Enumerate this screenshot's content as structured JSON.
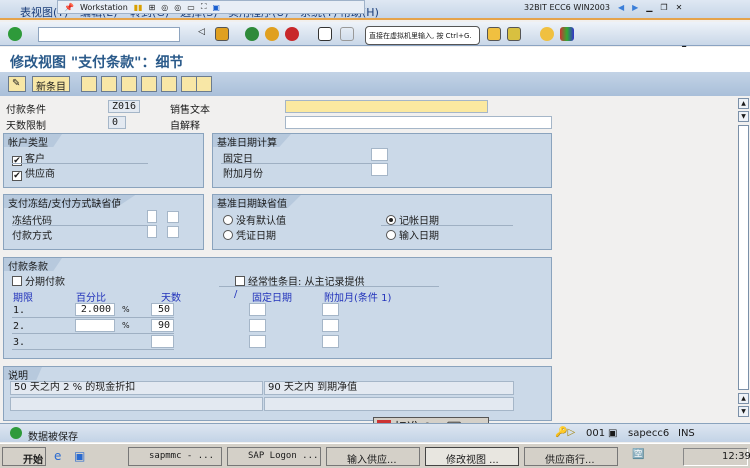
{
  "menu": {
    "items": [
      "表视图(T)",
      "编辑(E)",
      "转到(G)",
      "选择(S)",
      "实用程序(U)",
      "系统(Y)",
      "帮助(H)"
    ]
  },
  "vm": {
    "workstation": "Workstation",
    "vm_name": "32BIT ECC6 WIN2003"
  },
  "tooltip": "直接在虚拟机里输入, 按 Ctrl+G.",
  "command_field": {
    "value": ""
  },
  "page_title": "修改视图 \"支付条款\"：细节",
  "app_toolbar": {
    "new_entries": "新条目"
  },
  "header": {
    "payment_terms_label": "付款条件",
    "payment_terms_value": "Z016",
    "day_limit_label": "天数限制",
    "day_limit_value": "0",
    "sales_text_label": "销售文本",
    "sales_text_value": "",
    "own_explanation_label": "自解释",
    "own_explanation_value": ""
  },
  "account_type": {
    "title": "帐户类型",
    "customer": "客户",
    "customer_checked": true,
    "vendor": "供应商",
    "vendor_checked": true
  },
  "baseline_calc": {
    "title": "基准日期计算",
    "fixed_day": "固定日",
    "additional_months": "附加月份"
  },
  "payment_block": {
    "title": "支付冻结/支付方式缺省值",
    "block_key": "冻结代码",
    "payment_method": "付款方式"
  },
  "baseline_default": {
    "title": "基准日期缺省值",
    "no_default": "没有默认值",
    "posting_date": "记帐日期",
    "document_date": "凭证日期",
    "entry_date": "输入日期",
    "selected": "posting_date"
  },
  "terms": {
    "title": "付款条款",
    "installment": "分期付款",
    "recurring": "经常性条目: 从主记录提供",
    "col_term": "期限",
    "col_percent": "百分比",
    "col_days": "天数",
    "col_slash": "/",
    "col_fixed": "固定日期",
    "col_addmonth": "附加月(条件 1)",
    "pct_sign": "%",
    "rows": [
      {
        "no": "1.",
        "percent": "2.000",
        "days": "50"
      },
      {
        "no": "2.",
        "percent": "",
        "days": "90"
      },
      {
        "no": "3.",
        "percent": "",
        "days": ""
      }
    ]
  },
  "explanation": {
    "title": "说明",
    "line1a": "50 天之内 2 % 的现金折扣",
    "line1b": "90 天之内 到期净值"
  },
  "ime": {
    "mode": "标准"
  },
  "status": {
    "message": "数据被保存",
    "client": "001",
    "server": "sapecc6",
    "mode": "INS"
  },
  "taskbar": {
    "start": "开始",
    "tasks": [
      "sapmmc - ...",
      "SAP Logon ...",
      "输入供应...",
      "修改视图 ...",
      "供应商行..."
    ],
    "clock": "12:39"
  },
  "colors": {
    "accent": "#e5a34a",
    "group_bg": "#cbd9e8",
    "title": "#2a5a8a",
    "required_field": "#fbe9a0"
  }
}
